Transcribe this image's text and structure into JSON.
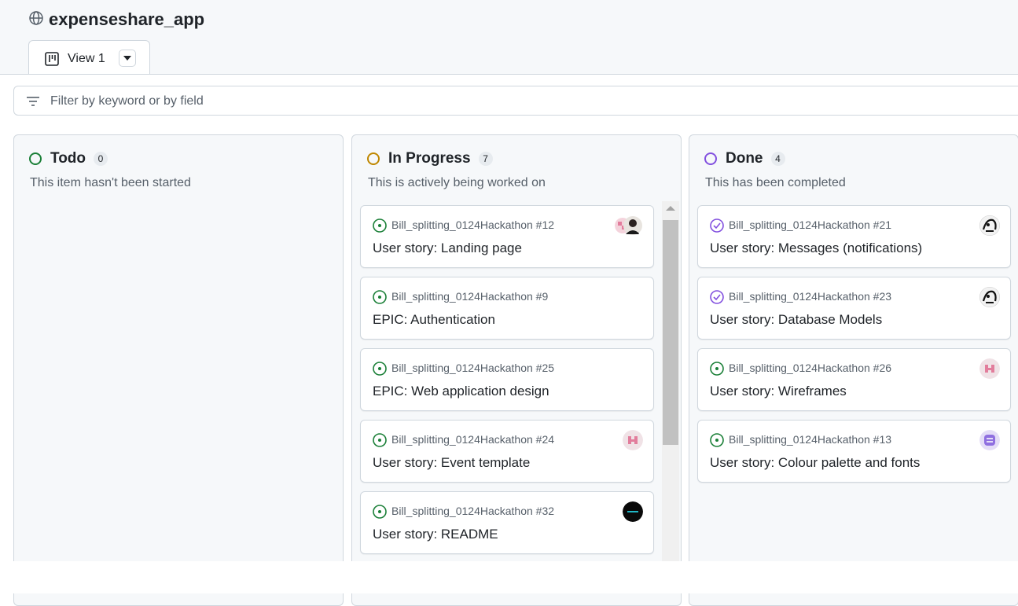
{
  "header": {
    "title": "expenseshare_app",
    "globe_icon": "globe-icon"
  },
  "view_tab": {
    "label": "View 1",
    "icon": "project-board-icon",
    "menu_icon": "triangle-down-icon"
  },
  "filter": {
    "placeholder": "Filter by keyword or by field",
    "value": ""
  },
  "colors": {
    "todo": "#1a7f37",
    "in_progress": "#bf8700",
    "done": "#8250df",
    "open_issue": "#1a7f37",
    "closed_issue": "#8250df"
  },
  "columns": [
    {
      "name": "Todo",
      "count": "0",
      "description": "This item hasn't been started",
      "cards": []
    },
    {
      "name": "In Progress",
      "count": "7",
      "description": "This is actively being worked on",
      "cards": [
        {
          "ref": "Bill_splitting_0124Hackathon #12",
          "title": "User story: Landing page",
          "state": "open",
          "avatar": "double"
        },
        {
          "ref": "Bill_splitting_0124Hackathon #9",
          "title": "EPIC: Authentication",
          "state": "open",
          "avatar": ""
        },
        {
          "ref": "Bill_splitting_0124Hackathon #25",
          "title": "EPIC: Web application design",
          "state": "open",
          "avatar": ""
        },
        {
          "ref": "Bill_splitting_0124Hackathon #24",
          "title": "User story: Event template",
          "state": "open",
          "avatar": "pink-identicon"
        },
        {
          "ref": "Bill_splitting_0124Hackathon #32",
          "title": "User story: README",
          "state": "open",
          "avatar": "dark"
        }
      ]
    },
    {
      "name": "Done",
      "count": "4",
      "description": "This has been completed",
      "cards": [
        {
          "ref": "Bill_splitting_0124Hackathon #21",
          "title": "User story: Messages (notifications)",
          "state": "closed",
          "avatar": "sketch"
        },
        {
          "ref": "Bill_splitting_0124Hackathon #23",
          "title": "User story: Database Models",
          "state": "closed",
          "avatar": "sketch"
        },
        {
          "ref": "Bill_splitting_0124Hackathon #26",
          "title": "User story: Wireframes",
          "state": "open",
          "avatar": "pink-identicon"
        },
        {
          "ref": "Bill_splitting_0124Hackathon #13",
          "title": "User story: Colour palette and fonts",
          "state": "open",
          "avatar": "purple-identicon"
        }
      ]
    }
  ]
}
